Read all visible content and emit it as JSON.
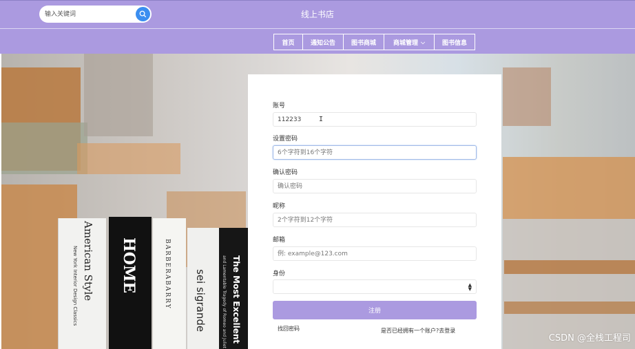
{
  "header": {
    "search_placeholder": "输入关键词",
    "site_title": "线上书店"
  },
  "nav": {
    "items": [
      {
        "label": "首页"
      },
      {
        "label": "通知公告"
      },
      {
        "label": "图书商城"
      },
      {
        "label": "商城管理",
        "dropdown": true
      },
      {
        "label": "图书信息"
      }
    ]
  },
  "form": {
    "account_label": "账号",
    "account_value": "112233",
    "password_label": "设置密码",
    "password_placeholder": "6个字符到16个字符",
    "confirm_label": "确认密码",
    "confirm_placeholder": "确认密码",
    "nickname_label": "昵称",
    "nickname_placeholder": "2个字符到12个字符",
    "email_label": "邮箱",
    "email_placeholder": "例: example@123.com",
    "role_label": "身份",
    "role_value": "",
    "submit_label": "注册",
    "forgot_link": "找回密码",
    "login_link": "是否已经拥有一个账户?去登录"
  },
  "background_books": {
    "book1": "American Style",
    "book1_sub": "New York Interior Design Classics",
    "book2": "HOME",
    "book3": "BARBERABARRY",
    "book4": "sei sigrande",
    "book5": "The Most Excellent",
    "book5_sub": "and Lamentable Tragedy of Romeo and Juliet"
  },
  "watermark": "CSDN @全栈工程司",
  "colors": {
    "accent": "#ab9ae0",
    "search_button": "#3b8ef0"
  }
}
